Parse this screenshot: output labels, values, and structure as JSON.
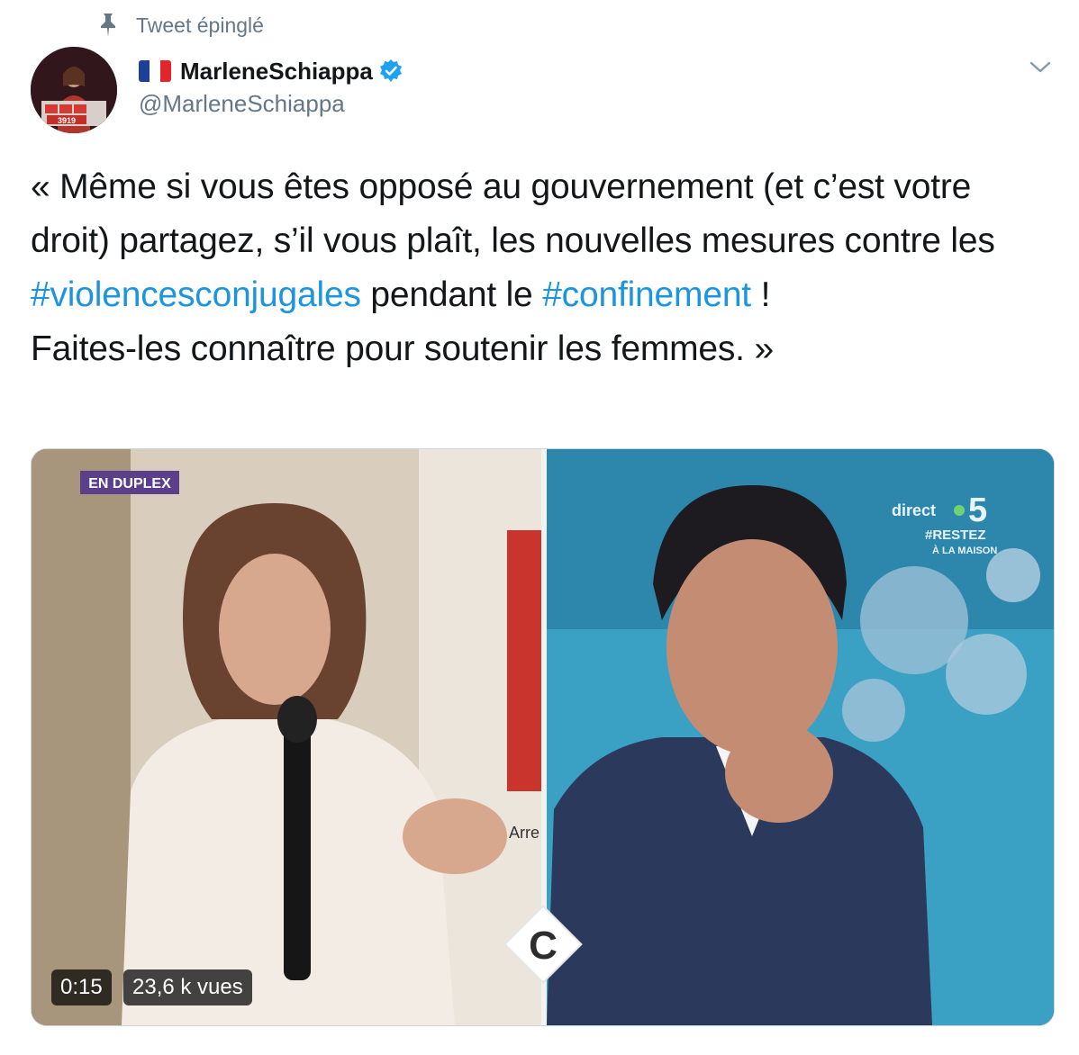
{
  "pinned_label": "Tweet épinglé",
  "author": {
    "display_name": "MarleneSchiappa",
    "handle": "@MarleneSchiappa",
    "verified": true,
    "flag": "france-flag-icon",
    "avatar_sign_text": "3919"
  },
  "tweet": {
    "text_before_tag1": "« Même si vous êtes opposé au gouvernement (et c’est votre droit) partagez, s’il vous plaît, les nouvelles mesures contre les ",
    "hashtag1": "#violencesconjugales",
    "text_between": " pendant le ",
    "hashtag2": "#confinement",
    "text_after_tag2": " !",
    "second_line": "Faites-les connaître pour soutenir les femmes. »"
  },
  "video": {
    "overlay_left_label": "EN DUPLEX",
    "channel_label": "direct",
    "channel_number": "5",
    "channel_tag": "#RESTEZ",
    "channel_tag_sub": "À LA MAISON",
    "backdrop_poster_text": "Arre",
    "show_logo": "C",
    "duration": "0:15",
    "views": "23,6 k vues"
  },
  "colors": {
    "link": "#1b95e0",
    "secondary_text": "#657786",
    "verified": "#1da1f2"
  }
}
